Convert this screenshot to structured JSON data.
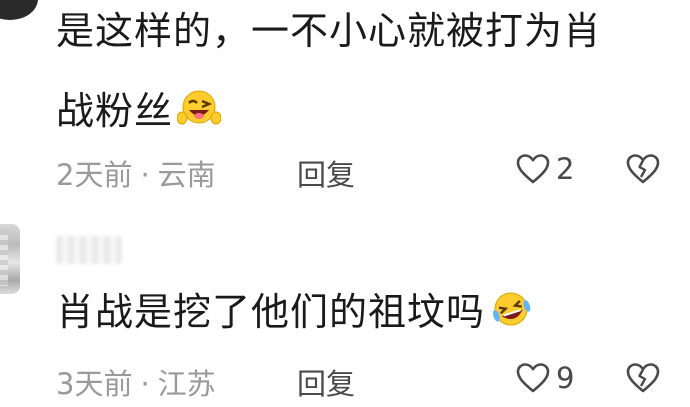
{
  "comments": [
    {
      "line1": "是这样的，一不小心就被打为肖",
      "line2": "战粉丝",
      "time": "2天前",
      "location": "云南",
      "reply_label": "回复",
      "likes": "2"
    },
    {
      "line1": "肖战是挖了他们的祖坟吗",
      "time": "3天前",
      "location": "江苏",
      "reply_label": "回复",
      "likes": "9"
    }
  ],
  "separator": "·",
  "icons": {
    "comment1_emoji": "wink-tongue-hands-emoji",
    "comment2_emoji": "rolling-laughing-emoji",
    "like": "heart-outline-icon",
    "dislike": "broken-heart-outline-icon"
  }
}
